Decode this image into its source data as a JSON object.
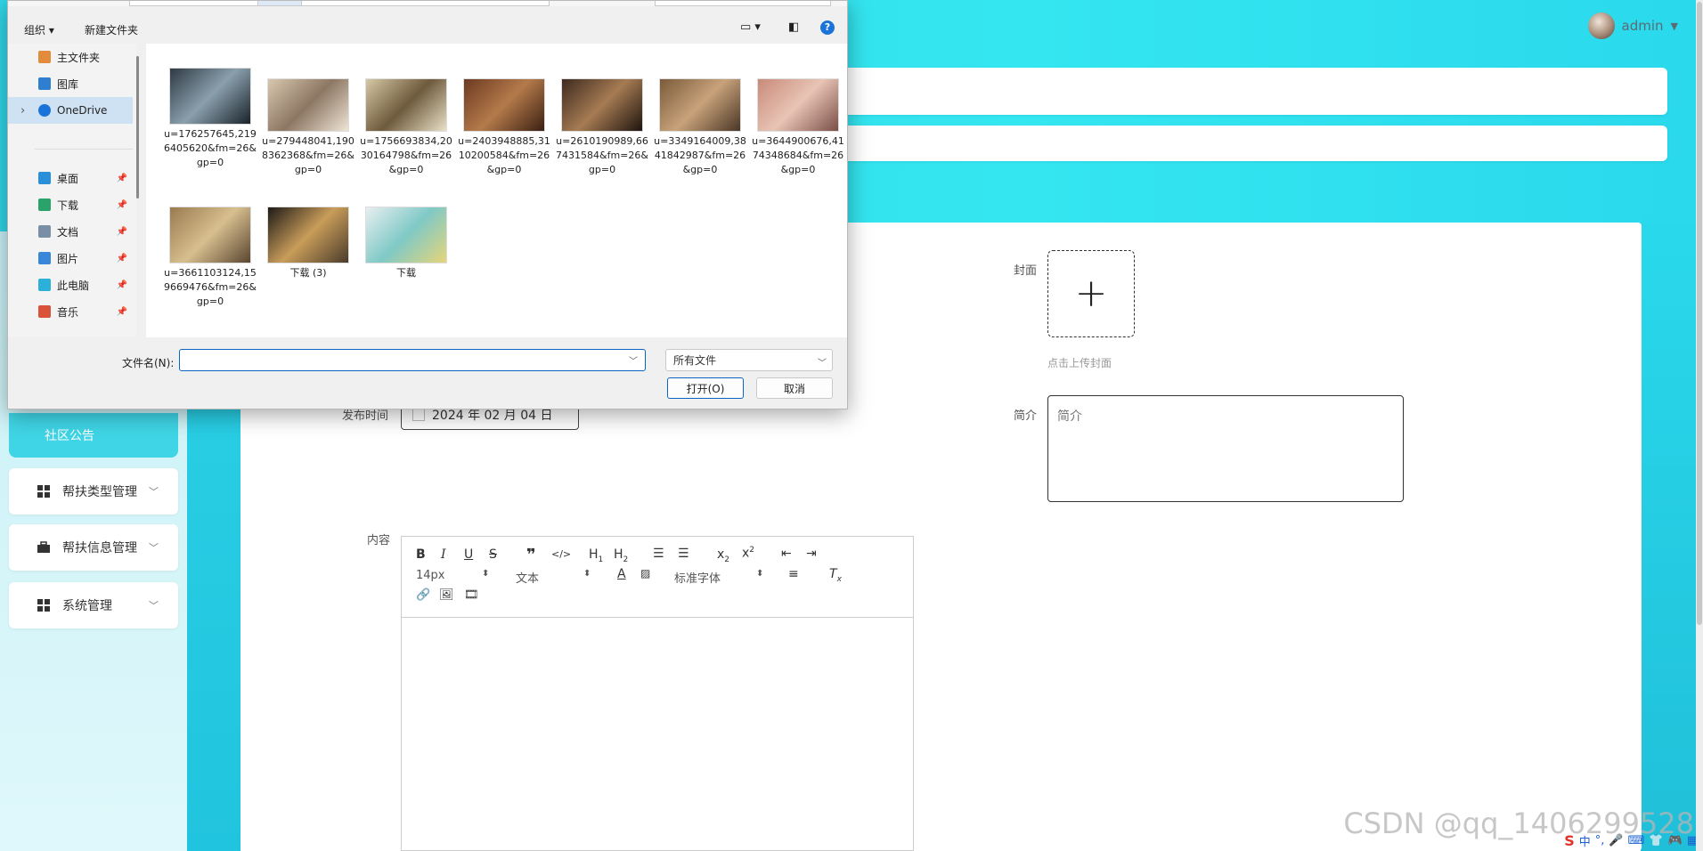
{
  "header": {
    "username": "admin"
  },
  "sidebar": {
    "active_item": "社区公告",
    "items": [
      {
        "label": "帮扶类型管理",
        "icon": "grid-icon"
      },
      {
        "label": "帮扶信息管理",
        "icon": "briefcase-icon"
      },
      {
        "label": "系统管理",
        "icon": "grid-icon"
      }
    ]
  },
  "form": {
    "cover_label": "封面",
    "cover_hint": "点击上传封面",
    "intro_label": "简介",
    "intro_placeholder": "简介",
    "publish_label": "发布时间",
    "publish_value": "2024 年 02 月 04 日",
    "content_label": "内容"
  },
  "editor": {
    "font_size": "14px",
    "text_style": "文本",
    "font_family": "标准字体"
  },
  "dialog": {
    "toolbar": {
      "organize": "组织 ▾",
      "new_folder": "新建文件夹"
    },
    "nav": [
      {
        "label": "主文件夹",
        "icon": "home-icon",
        "color": "#e28b3d",
        "pinned": false
      },
      {
        "label": "图库",
        "icon": "gallery-icon",
        "color": "#2f7fd1",
        "pinned": false
      },
      {
        "label": "OneDrive",
        "icon": "cloud-icon",
        "color": "#1a73d8",
        "pinned": false
      },
      {
        "label": "桌面",
        "icon": "desktop-icon",
        "color": "#2a8fd9",
        "pinned": true
      },
      {
        "label": "下载",
        "icon": "download-icon",
        "color": "#2aa36b",
        "pinned": true
      },
      {
        "label": "文档",
        "icon": "document-icon",
        "color": "#7a8fa6",
        "pinned": true
      },
      {
        "label": "图片",
        "icon": "pictures-icon",
        "color": "#3a87d9",
        "pinned": true
      },
      {
        "label": "此电脑",
        "icon": "computer-icon",
        "color": "#2ab0d9",
        "pinned": true
      },
      {
        "label": "音乐",
        "icon": "music-icon",
        "color": "#d9533a",
        "pinned": true
      }
    ],
    "files": [
      {
        "name": "u=176257645,2196405620&fm=26&gp=0"
      },
      {
        "name": "u=279448041,1908362368&fm=26&gp=0"
      },
      {
        "name": "u=1756693834,2030164798&fm=26&gp=0"
      },
      {
        "name": "u=2403948885,3110200584&fm=26&gp=0"
      },
      {
        "name": "u=2610190989,667431584&fm=26&gp=0"
      },
      {
        "name": "u=3349164009,3841842987&fm=26&gp=0"
      },
      {
        "name": "u=3644900676,4174348684&fm=26&gp=0"
      },
      {
        "name": "u=3661103124,159669476&fm=26&gp=0"
      },
      {
        "name": "下载 (3)"
      },
      {
        "name": "下载"
      }
    ],
    "filename_label": "文件名(N):",
    "filename_value": "",
    "filetype": "所有文件",
    "open_label": "打开(O)",
    "cancel_label": "取消"
  },
  "watermark": "CSDN @qq_1406299528",
  "ime": {
    "label": "中"
  }
}
